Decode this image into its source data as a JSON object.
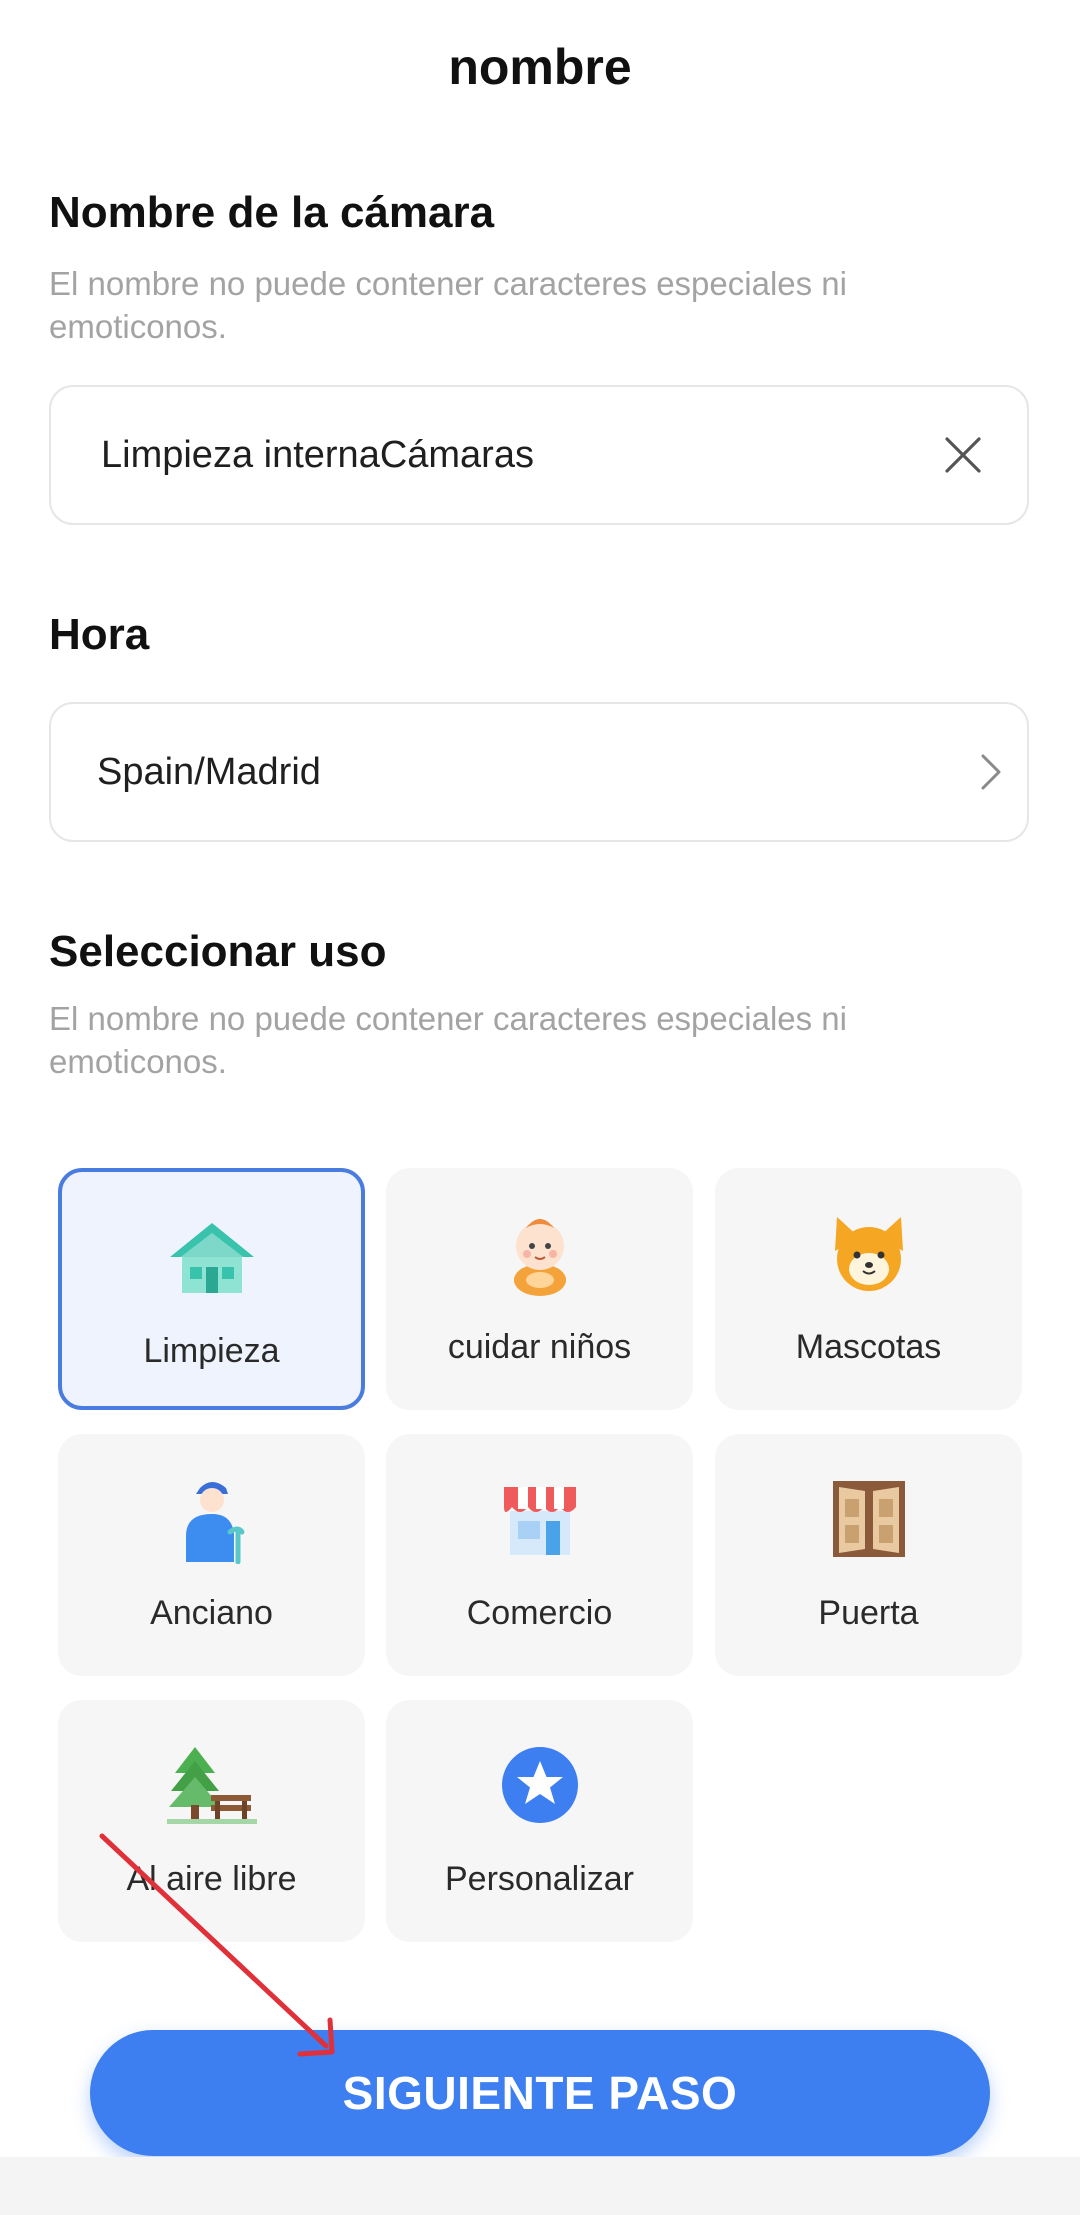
{
  "header": {
    "title": "nombre"
  },
  "camera_name": {
    "title": "Nombre de la cámara",
    "hint": "El nombre no puede contener caracteres especiales ni emoticonos.",
    "value": "Limpieza internaCámaras",
    "clear_icon": "close-icon"
  },
  "time": {
    "title": "Hora",
    "value": "Spain/Madrid",
    "chevron_icon": "chevron-right-icon"
  },
  "usage": {
    "title": "Seleccionar uso",
    "hint": "El nombre no puede contener caracteres especiales ni emoticonos.",
    "selected": "Limpieza",
    "options": [
      {
        "label": "Limpieza",
        "icon": "house-icon"
      },
      {
        "label": "cuidar niños",
        "icon": "baby-icon"
      },
      {
        "label": "Mascotas",
        "icon": "pet-icon"
      },
      {
        "label": "Anciano",
        "icon": "elderly-icon"
      },
      {
        "label": "Comercio",
        "icon": "store-icon"
      },
      {
        "label": "Puerta",
        "icon": "door-icon"
      },
      {
        "label": "Al aire libre",
        "icon": "outdoor-icon"
      },
      {
        "label": "Personalizar",
        "icon": "star-icon"
      }
    ]
  },
  "footer": {
    "next_label": "SIGUIENTE PASO"
  },
  "colors": {
    "accent": "#3d7ef0",
    "selected_border": "#4a7ce0",
    "selected_bg": "#eef3fd",
    "annotation_arrow": "#e0303a"
  }
}
